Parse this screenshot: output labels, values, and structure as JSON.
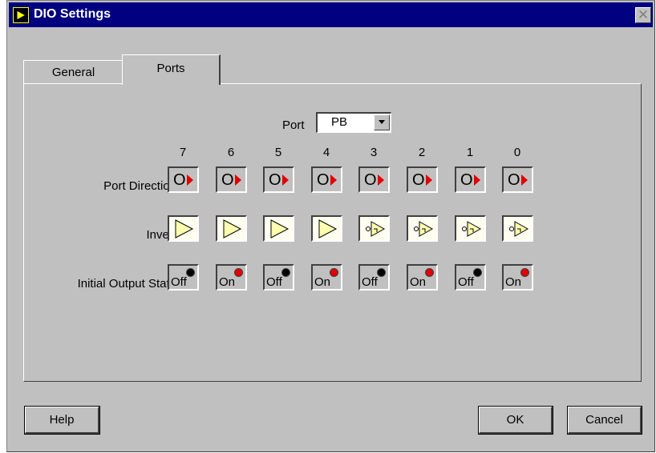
{
  "window": {
    "title": "DIO Settings",
    "close_glyph": "✕"
  },
  "tabs": [
    {
      "label": "General",
      "active": false
    },
    {
      "label": "Ports",
      "active": true
    }
  ],
  "port": {
    "label": "Port",
    "value": "PB"
  },
  "bits": [
    "7",
    "6",
    "5",
    "4",
    "3",
    "2",
    "1",
    "0"
  ],
  "rows": {
    "direction": {
      "label": "Port Direction",
      "values": [
        "O",
        "O",
        "O",
        "O",
        "O",
        "O",
        "O",
        "O"
      ]
    },
    "invert": {
      "label": "Invert",
      "values": [
        false,
        false,
        false,
        false,
        true,
        true,
        true,
        true
      ]
    },
    "initial_state": {
      "label": "Initial Output State",
      "values": [
        "Off",
        "On",
        "Off",
        "On",
        "Off",
        "On",
        "Off",
        "On"
      ]
    }
  },
  "buttons": {
    "help": "Help",
    "ok": "OK",
    "cancel": "Cancel"
  },
  "colors": {
    "titlebar": "#000080",
    "face": "#c0c0c0",
    "led_on": "#e00000",
    "led_off": "#000000",
    "direction_arrow": "#e00000",
    "buffer_fill": "#ffffb0"
  }
}
